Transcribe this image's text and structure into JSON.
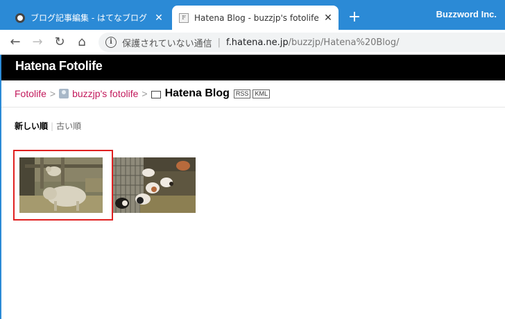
{
  "browser": {
    "tabs": [
      {
        "title": "ブログ記事編集 - はてなブログ",
        "active": false,
        "close": "✕"
      },
      {
        "title": "Hatena Blog - buzzjp's fotolife",
        "active": true,
        "close": "✕",
        "favicon": "F"
      }
    ],
    "new_tab": "+",
    "profile": "Buzzword Inc.",
    "nav": {
      "back": "←",
      "forward": "→",
      "reload": "↻",
      "home": "⌂"
    },
    "address": {
      "info_icon": "i",
      "security_text": "保護されていない通信",
      "separator": "|",
      "host": "f.hatena.ne.jp",
      "path": "/buzzjp/Hatena%20Blog/"
    }
  },
  "page": {
    "logo": "Hatena Fotolife",
    "breadcrumb": {
      "root": "Fotolife",
      "sep": ">",
      "user": "buzzjp's fotolife",
      "album": "Hatena Blog",
      "rss": "RSS",
      "kml": "KML"
    },
    "sort": {
      "newest": "新しい順",
      "bar": "|",
      "oldest": "古い順"
    },
    "colors": {
      "accent": "#c2185b",
      "highlight": "#e02020",
      "tabstrip": "#2b8ad6"
    },
    "thumbnails": [
      {
        "subject": "sheep",
        "selected": true
      },
      {
        "subject": "guinea pigs",
        "selected": false
      }
    ]
  }
}
